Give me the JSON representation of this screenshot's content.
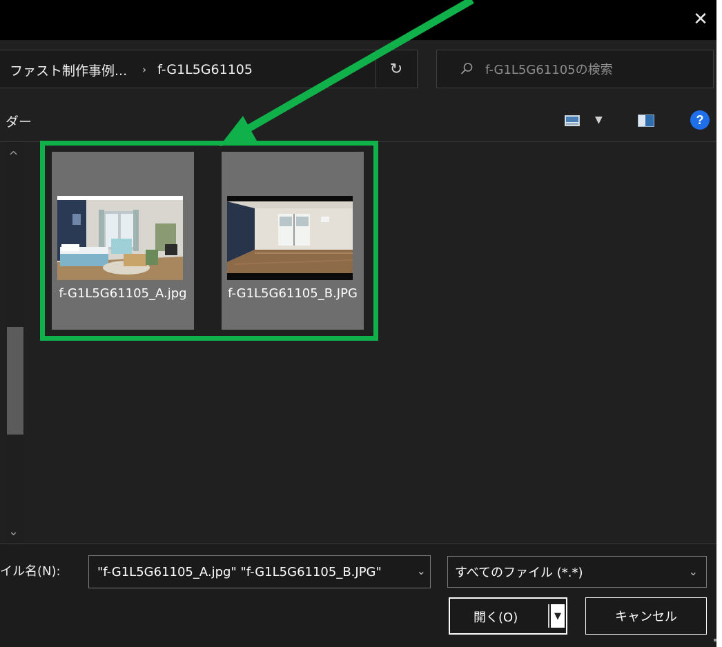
{
  "title_bar": {
    "close_glyph": "✕"
  },
  "address_bar": {
    "path_parent": "ファスト制作事例...",
    "separator": "›",
    "path_current": "f-G1L5G61105",
    "dropdown_glyph": "⌄",
    "refresh_glyph": "↻"
  },
  "search": {
    "placeholder": "f-G1L5G61105の検索",
    "icon": "search-icon"
  },
  "toolbar": {
    "folder_label": "ダー",
    "view_icon": "view-icon",
    "view_dropdown_glyph": "▼",
    "preview_pane_icon": "preview-pane-icon",
    "help_label": "?"
  },
  "files": [
    {
      "name": "f-G1L5G61105_A.jpg"
    },
    {
      "name": "f-G1L5G61105_B.JPG"
    }
  ],
  "scrollbar": {
    "up_glyph": "^",
    "down_glyph": "⌄"
  },
  "bottom_bar": {
    "filename_label": "イル名(N):",
    "filename_value": "\"f-G1L5G61105_A.jpg\" \"f-G1L5G61105_B.JPG\"",
    "filename_dropdown_glyph": "⌄",
    "filetype_value": "すべてのファイル (*.*)",
    "filetype_dropdown_glyph": "⌄",
    "open_label": "開く(O)",
    "open_dropdown_glyph": "▼",
    "cancel_label": "キャンセル"
  },
  "colors": {
    "highlight": "#10b04a",
    "dialog_bg": "#202020",
    "tile_bg": "#6e6e6e",
    "help_blue": "#1f6feb"
  }
}
